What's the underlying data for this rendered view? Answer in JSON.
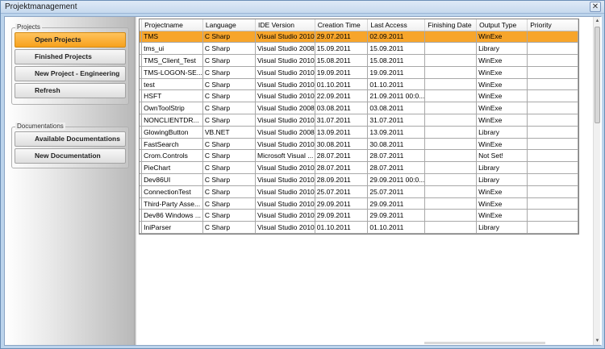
{
  "window": {
    "title": "Projektmanagement",
    "close_glyph": "✕"
  },
  "sidebar": {
    "projects_group": {
      "title": "Projects",
      "items": [
        {
          "label": "Open Projects"
        },
        {
          "label": "Finished Projects"
        },
        {
          "label": "New Project - Engineering"
        },
        {
          "label": "Refresh"
        }
      ]
    },
    "docs_group": {
      "title": "Documentations",
      "items": [
        {
          "label": "Available Documentations"
        },
        {
          "label": "New Documentation"
        }
      ]
    }
  },
  "grid": {
    "columns": [
      "Projectname",
      "Language",
      "IDE Version",
      "Creation Time",
      "Last Access",
      "Finishing Date",
      "Output Type",
      "Priority"
    ],
    "selected_row": 0,
    "selected_color": "#f7a52b",
    "rows": [
      [
        "TMS",
        "C Sharp",
        "Visual Studio 2010",
        "29.07.2011",
        "02.09.2011",
        "",
        "WinExe",
        ""
      ],
      [
        "tms_ui",
        "C Sharp",
        "Visual Studio 2008",
        "15.09.2011",
        "15.09.2011",
        "",
        "Library",
        ""
      ],
      [
        "TMS_Client_Test",
        "C Sharp",
        "Visual Studio 2010",
        "15.08.2011",
        "15.08.2011",
        "",
        "WinExe",
        ""
      ],
      [
        "TMS-LOGON-SE...",
        "C Sharp",
        "Visual Studio 2010",
        "19.09.2011",
        "19.09.2011",
        "",
        "WinExe",
        ""
      ],
      [
        "test",
        "C Sharp",
        "Visual Studio 2010",
        "01.10.2011",
        "01.10.2011",
        "",
        "WinExe",
        ""
      ],
      [
        "HSFT",
        "C Sharp",
        "Visual Studio 2010",
        "22.09.2011",
        "21.09.2011 00:0...",
        "",
        "WinExe",
        ""
      ],
      [
        "OwnToolStrip",
        "C Sharp",
        "Visual Studio 2008",
        "03.08.2011",
        "03.08.2011",
        "",
        "WinExe",
        ""
      ],
      [
        "NONCLIENTDR...",
        "C Sharp",
        "Visual Studio 2010",
        "31.07.2011",
        "31.07.2011",
        "",
        "WinExe",
        ""
      ],
      [
        "GlowingButton",
        "VB.NET",
        "Visual Studio 2008",
        "13.09.2011",
        "13.09.2011",
        "",
        "Library",
        ""
      ],
      [
        "FastSearch",
        "C Sharp",
        "Visual Studio 2010",
        "30.08.2011",
        "30.08.2011",
        "",
        "WinExe",
        ""
      ],
      [
        "Crom.Controls",
        "C Sharp",
        "Microsoft Visual ...",
        "28.07.2011",
        "28.07.2011",
        "",
        "Not Set!",
        ""
      ],
      [
        "PieChart",
        "C Sharp",
        "Visual Studio 2010",
        "28.07.2011",
        "28.07.2011",
        "",
        "Library",
        ""
      ],
      [
        "Dev86UI",
        "C Sharp",
        "Visual Studio 2010",
        "28.09.2011",
        "29.09.2011 00:0...",
        "",
        "Library",
        ""
      ],
      [
        "ConnectionTest",
        "C Sharp",
        "Visual Studio 2010",
        "25.07.2011",
        "25.07.2011",
        "",
        "WinExe",
        ""
      ],
      [
        "Third-Party Asse...",
        "C Sharp",
        "Visual Studio 2010",
        "29.09.2011",
        "29.09.2011",
        "",
        "WinExe",
        ""
      ],
      [
        "Dev86 Windows ...",
        "C Sharp",
        "Visual Studio 2010",
        "29.09.2011",
        "29.09.2011",
        "",
        "WinExe",
        ""
      ],
      [
        "IniParser",
        "C Sharp",
        "Visual Studio 2010",
        "01.10.2011",
        "01.10.2011",
        "",
        "Library",
        ""
      ]
    ]
  }
}
